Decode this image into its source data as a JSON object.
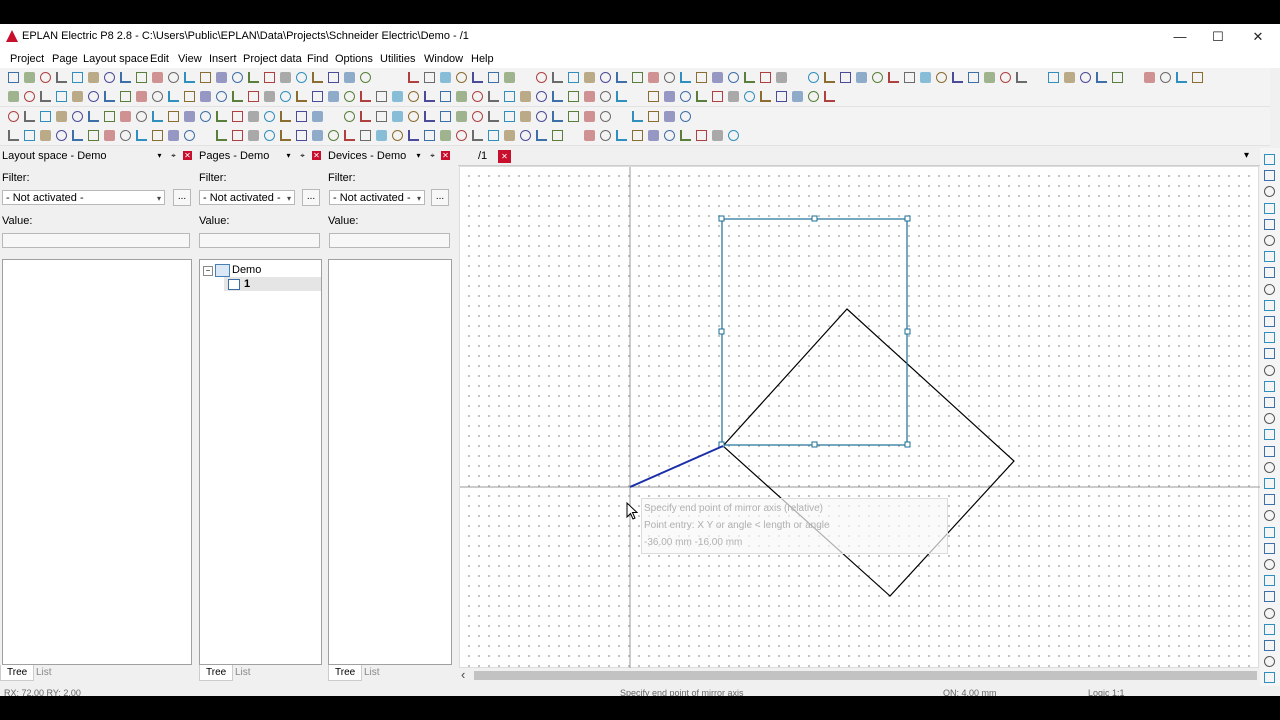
{
  "window": {
    "title": "EPLAN Electric P8 2.8 - C:\\Users\\Public\\EPLAN\\Data\\Projects\\Schneider Electric\\Demo - /1"
  },
  "window_controls": {
    "minimize": "—",
    "maximize": "☐",
    "close": "✕"
  },
  "menu": [
    "Project",
    "Page",
    "Layout space",
    "Edit",
    "View",
    "Insert",
    "Project data",
    "Find",
    "Options",
    "Utilities",
    "Window",
    "Help"
  ],
  "panels": [
    {
      "title": "Layout space - Demo",
      "filter_label": "Filter:",
      "filter_value": "- Not activated -",
      "value_label": "Value:",
      "tab_tree": "Tree",
      "tab_list": "List"
    },
    {
      "title": "Pages - Demo",
      "filter_label": "Filter:",
      "filter_value": "- Not activated -",
      "value_label": "Value:",
      "tab_tree": "Tree",
      "tab_list": "List",
      "tree": {
        "root": "Demo",
        "child": "1"
      }
    },
    {
      "title": "Devices - Demo",
      "filter_label": "Filter:",
      "filter_value": "- Not activated -",
      "value_label": "Value:",
      "tab_tree": "Tree",
      "tab_list": "List"
    }
  ],
  "panel_buttons": {
    "dropdown": "▾",
    "pin": "⌖",
    "close": "✕",
    "more": "...",
    "expand": "−"
  },
  "document_tab": {
    "label": "/1",
    "close": "✕",
    "menu": "▾"
  },
  "tooltip": {
    "line1": "Specify end point of mirror axis (relative)",
    "line2": "Point entry: X Y or angle < length or angle",
    "line3": "-36.00 mm  -16.00 mm"
  },
  "statusbar": {
    "coords": "RX: 72.00    RY: 2.00",
    "prompt": "Specify end point of mirror axis",
    "grid": "ON: 4.00 mm",
    "scale": "Logic 1:1"
  },
  "colors": {
    "accent": "#1f5fa8",
    "selection_frame": "#1a6e94",
    "close_red": "#c8102e"
  },
  "icons": {
    "scroll_left": "‹"
  }
}
